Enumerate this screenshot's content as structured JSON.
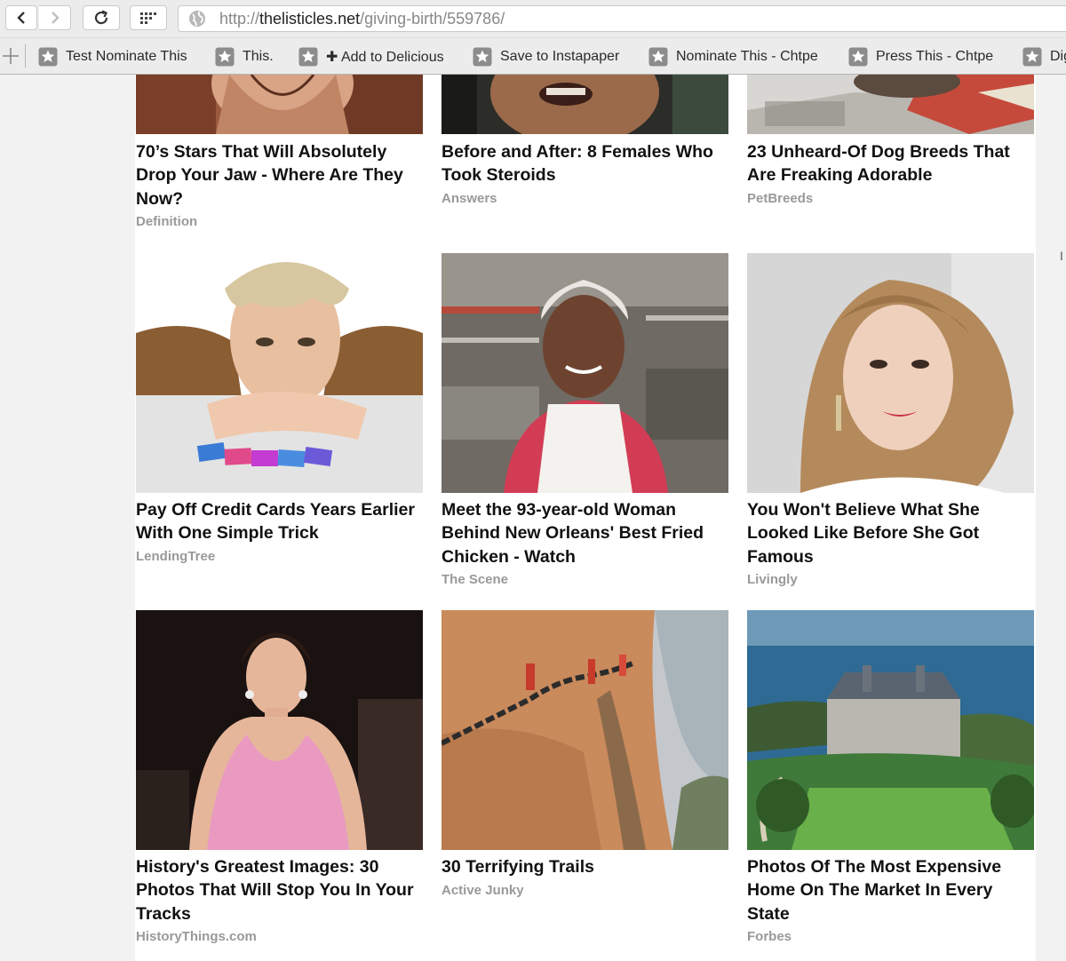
{
  "browser": {
    "url_domain": "thelisticles.net",
    "url_path": "/giving-birth/559786/",
    "url_scheme": "http://",
    "icons": [
      "back-arrow-icon",
      "forward-arrow-icon",
      "reload-icon",
      "grid-icon",
      "globe-icon",
      "plus-icon",
      "star-icon"
    ]
  },
  "bookmarks": [
    {
      "label": "Test Nominate This"
    },
    {
      "label": "This."
    },
    {
      "label": "✚ Add to Delicious"
    },
    {
      "label": "Save to Instapaper"
    },
    {
      "label": "Nominate This - Chtpe"
    },
    {
      "label": "Press This - Chtpe"
    },
    {
      "label": "Dig"
    }
  ],
  "articles": [
    {
      "title": "70’s Stars That Will Absolutely Drop Your Jaw - Where Are They Now?",
      "source": "Definition"
    },
    {
      "title": "Before and After: 8 Females Who Took Steroids",
      "source": "Answers"
    },
    {
      "title": "23 Unheard-Of Dog Breeds That Are Freaking Adorable",
      "source": "PetBreeds"
    },
    {
      "title": "Pay Off Credit Cards Years Earlier With One Simple Trick",
      "source": "LendingTree"
    },
    {
      "title": "Meet the 93-year-old Woman Behind New Orleans' Best Fried Chicken - Watch",
      "source": "The Scene"
    },
    {
      "title": "You Won't Believe What She Looked Like Before She Got Famous",
      "source": "Livingly"
    },
    {
      "title": "History's Greatest Images: 30 Photos That Will Stop You In Your Tracks",
      "source": "HistoryThings.com"
    },
    {
      "title": "30 Terrifying Trails",
      "source": "Active Junky"
    },
    {
      "title": "Photos Of The Most Expensive Home On The Market In Every State",
      "source": "Forbes"
    }
  ],
  "edge_fragment": "I"
}
